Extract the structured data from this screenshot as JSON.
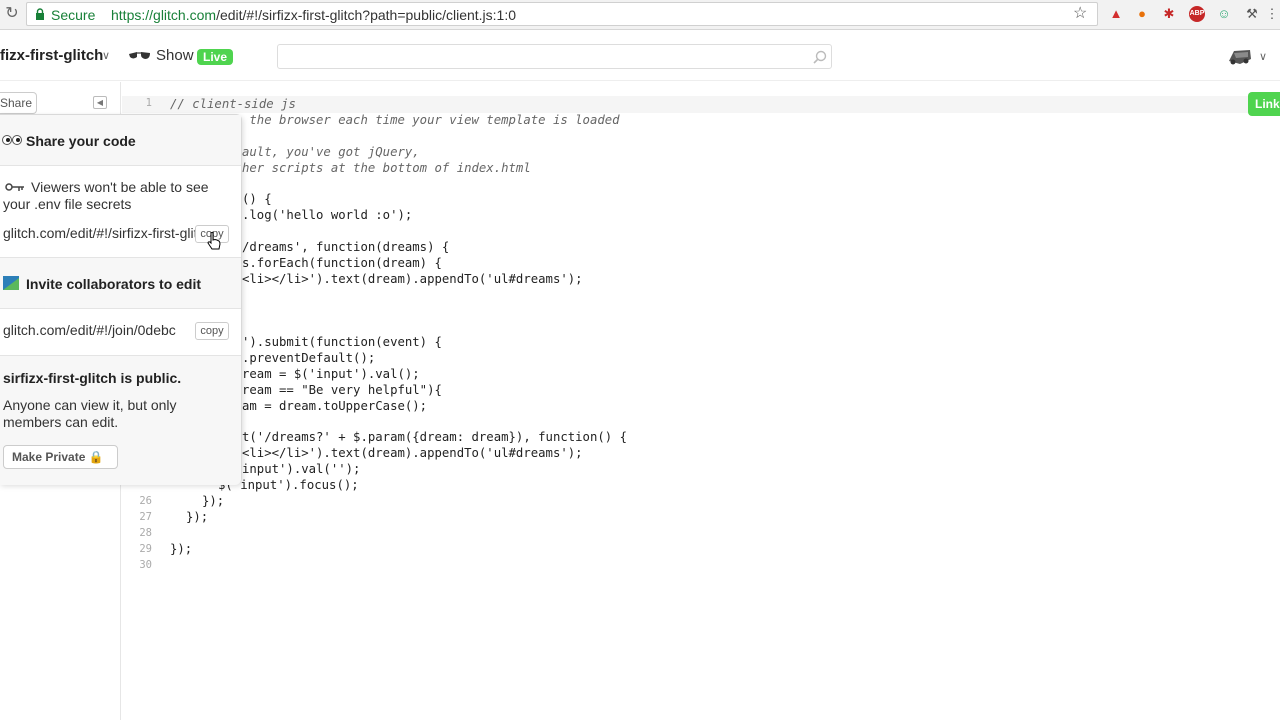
{
  "browser": {
    "secure_label": "Secure",
    "url_scheme": "https://",
    "url_host": "glitch.com",
    "url_path": "/edit/#!/sirfizx-first-glitch?path=public/client.js:1:0"
  },
  "header": {
    "project_name": "fizx-first-glitch",
    "show_label": "Show",
    "live_badge": "Live"
  },
  "sidebar": {
    "share_label": "Share"
  },
  "editor": {
    "link_badge": "Link",
    "line_numbers": [
      "1",
      "26",
      "27",
      "28",
      "29",
      "30"
    ],
    "lines": {
      "l1": "// client-side js",
      "l2": " the browser each time your view template is loaded",
      "l4": "ault, you've got jQuery,",
      "l5": "her scripts at the bottom of index.html",
      "l7": "() {",
      "l8": ".log('hello world :o');",
      "l10": "/dreams', function(dreams) {",
      "l11": "s.forEach(function(dream) {",
      "l12": "<li></li>').text(dream).appendTo('ul#dreams');",
      "l16": "').submit(function(event) {",
      "l17": ".preventDefault();",
      "l18": "ream = $('input').val();",
      "l19": "ream == \"Be very helpful\"){",
      "l20": "am = dream.toUpperCase();",
      "l22": "t('/dreams?' + $.param({dream: dream}), function() {",
      "l23": "<li></li>').text(dream).appendTo('ul#dreams');",
      "l24": "input').val('');",
      "l25": "$('input').focus();",
      "l26": "});",
      "l27": "});",
      "l29": "});"
    }
  },
  "share_popover": {
    "title": "Share your code",
    "viewers_note": "Viewers won't be able to see your .env file secrets",
    "view_url": "glitch.com/edit/#!/sirfizx-first-glitch",
    "copy_label": "copy",
    "invite_title": "Invite collaborators to edit",
    "invite_url": "glitch.com/edit/#!/join/0debc",
    "public_title": "sirfizx-first-glitch is public.",
    "public_desc": "Anyone can view it, but only members can edit.",
    "make_private_label": "Make Private 🔒"
  },
  "icons": {
    "eyes": "eyes-icon",
    "key": "key-icon",
    "invite": "collaborators-icon",
    "lock": "lock-icon"
  },
  "colors": {
    "live_green": "#4fd44f",
    "secure_green": "#188038"
  }
}
